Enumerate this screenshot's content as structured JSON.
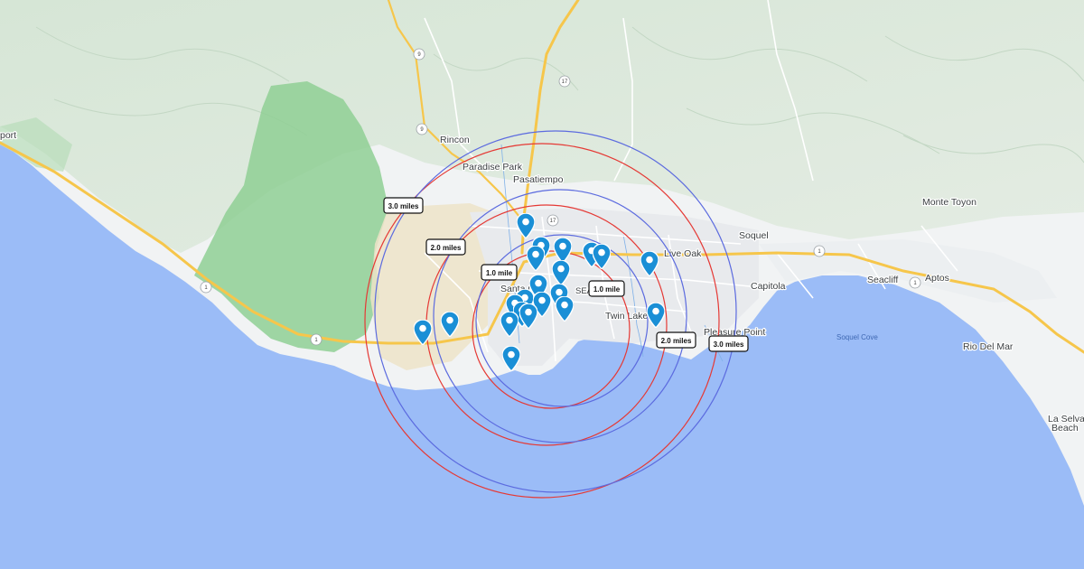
{
  "map": {
    "places": [
      {
        "id": "rincon",
        "name": "Rincon"
      },
      {
        "id": "paradise-park",
        "name": "Paradise Park"
      },
      {
        "id": "pasatiempo",
        "name": "Pasatiempo"
      },
      {
        "id": "soquel",
        "name": "Soquel"
      },
      {
        "id": "live-oak",
        "name": "Live Oak"
      },
      {
        "id": "capitola",
        "name": "Capitola"
      },
      {
        "id": "seacliff",
        "name": "Seacliff"
      },
      {
        "id": "aptos",
        "name": "Aptos"
      },
      {
        "id": "monte-toyon",
        "name": "Monte Toyon"
      },
      {
        "id": "rio-del-mar",
        "name": "Rio Del Mar"
      },
      {
        "id": "la-selva-beach-1",
        "name": "La Selva"
      },
      {
        "id": "la-selva-beach-2",
        "name": "Beach"
      },
      {
        "id": "twin-lakes",
        "name": "Twin Lakes"
      },
      {
        "id": "pleasure-point",
        "name": "Pleasure Point"
      },
      {
        "id": "santa-cruz",
        "name": "Santa C"
      },
      {
        "id": "seabright",
        "name": "SEA"
      },
      {
        "id": "davenport-partial",
        "name": "port"
      }
    ],
    "water_labels": [
      {
        "id": "soquel-cove",
        "name": "Soquel Cove"
      }
    ],
    "highway_shields": [
      "9",
      "17",
      "1"
    ],
    "radius_labels": [
      {
        "id": "r3-west",
        "text": "3.0 miles"
      },
      {
        "id": "r2-west",
        "text": "2.0 miles"
      },
      {
        "id": "r1-west",
        "text": "1.0 mile"
      },
      {
        "id": "r1-east",
        "text": "1.0 mile"
      },
      {
        "id": "r2-east",
        "text": "2.0 miles"
      },
      {
        "id": "r3-east",
        "text": "3.0 miles"
      }
    ],
    "circle_colors": {
      "red": "#e53935",
      "blue": "#5c6bdf"
    },
    "marker_color": "#1a8fd6",
    "marker_count": 24,
    "colors": {
      "ocean": "#9bbcf7",
      "land": "#f1f3f4",
      "terrain": "#cfe3d2",
      "park": "#8fcf94",
      "highway": "#f6c64b",
      "urban": "#e8eaed"
    }
  }
}
